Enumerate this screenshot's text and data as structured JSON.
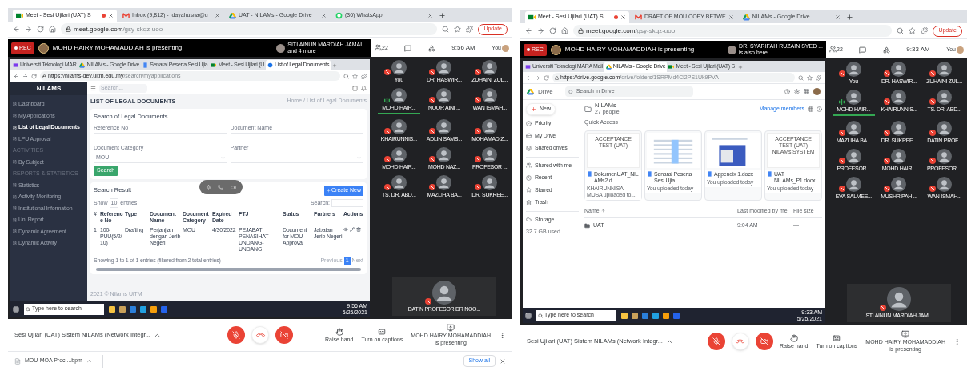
{
  "panels": [
    {
      "browser_tabs": [
        {
          "kind": "meet",
          "label": "Meet - Sesi Ujilari (UAT) S",
          "selected": true
        },
        {
          "kind": "gmail",
          "label": "Inbox (9,812) - Idayahusna@u",
          "selected": false
        },
        {
          "kind": "drive",
          "label": "UAT - NILAMs - Google Drive",
          "selected": false
        },
        {
          "kind": "whatsapp",
          "label": "(36) WhatsApp",
          "selected": false
        }
      ],
      "address": {
        "host": "meet.google.com",
        "path": "/gsy-skqz-uoo"
      },
      "update_button": "Update",
      "meet_header": {
        "rec": "REC",
        "presenter": "MOHD HAIRY MOHAMADDIAH is presenting",
        "also_here": {
          "name": "SITI AINUN MARDIAH JAMAL...",
          "detail": "and 4 more"
        },
        "people_count": "22",
        "time": "9:56 AM",
        "you": "You"
      },
      "shared_screen": {
        "kind": "nilams",
        "tabs": [
          {
            "kind": "mail",
            "label": "Universiti Teknologi MAR",
            "selected": false
          },
          {
            "kind": "drive",
            "label": "NILAMs - Google Drive",
            "selected": false
          },
          {
            "kind": "docs",
            "label": "Senarai Peserta Sesi Ujia",
            "selected": false
          },
          {
            "kind": "meet",
            "label": "Meet - Sesi Ujilari (U",
            "selected": false
          },
          {
            "kind": "page",
            "label": "List of Legal Documents",
            "selected": true
          }
        ],
        "url": {
          "host": "https://nilams-dev.uitm.edu.my",
          "path": "/search/myapplications"
        },
        "app": {
          "logo": "NILAMS",
          "search": "Search...",
          "nav": [
            {
              "kind": "item",
              "label": "Dashboard",
              "selected": false
            },
            {
              "kind": "item",
              "label": "My Applications",
              "selected": false
            },
            {
              "kind": "item",
              "label": "List of Legal Documents",
              "selected": true
            },
            {
              "kind": "item",
              "label": "LPU Approval",
              "selected": false
            },
            {
              "kind": "section",
              "label": "ACTIVITIES",
              "selected": false
            },
            {
              "kind": "item",
              "label": "By Subject",
              "selected": false
            },
            {
              "kind": "section",
              "label": "REPORTS & STATISTICS",
              "selected": false
            },
            {
              "kind": "item",
              "label": "Statistics",
              "selected": false
            },
            {
              "kind": "item",
              "label": "Activity Monitoring",
              "selected": false
            },
            {
              "kind": "item",
              "label": "Institutional Information",
              "selected": false
            },
            {
              "kind": "item",
              "label": "Uni Report",
              "selected": false
            },
            {
              "kind": "item",
              "label": "Dynamic Agreement",
              "selected": false
            },
            {
              "kind": "item",
              "label": "Dynamic Activity",
              "selected": false
            }
          ],
          "heading": "LIST OF LEGAL DOCUMENTS",
          "breadcrumb": "Home / List of Legal Documents",
          "search_card": {
            "title": "Search of Legal Documents",
            "fields": [
              {
                "kind": "text",
                "label": "Reference No"
              },
              {
                "kind": "text",
                "label": "Document Name"
              },
              {
                "kind": "select",
                "label": "Document Category",
                "value": "MOU"
              },
              {
                "kind": "select",
                "label": "Partner"
              }
            ],
            "button": "Search"
          },
          "results": {
            "title": "Search Result",
            "create": "Create New",
            "show": "Show",
            "page_size": "10",
            "entries": "entries",
            "search_label": "Search:",
            "columns": [
              "#",
              "Reference No",
              "Type",
              "Document Name",
              "Document Category",
              "Expired Date",
              "PTJ",
              "Status",
              "Partners",
              "Actions"
            ],
            "rows": [
              [
                "1",
                "100-PUU(5/2/10)",
                "Drafting",
                "Perjanjian dengan Jerib Negeri",
                "MOU",
                "4/30/2022",
                "PEJABAT PENASIHAT UNDANG-UNDANG",
                "Document for MOU Approval",
                "Jabatan Jerib Negeri"
              ]
            ],
            "info": "Showing 1 to 1 of 1 entries (filtered from 2 total entries)",
            "prev": "Previous",
            "page": "1",
            "next": "Next"
          },
          "footer": "2021 © Nilams UiTM"
        },
        "taskbar": {
          "search": "Type here to search",
          "time": "9:56 AM",
          "date": "5/25/2021"
        }
      },
      "participants": [
        {
          "name": "You",
          "speaking": false
        },
        {
          "name": "DR. HASWIR...",
          "speaking": false
        },
        {
          "name": "ZUHAINI ZUL...",
          "speaking": false
        },
        {
          "name": "MOHD HAIR...",
          "speaking": true
        },
        {
          "name": "NOOR AINI ...",
          "speaking": false
        },
        {
          "name": "WAN ISMAH...",
          "speaking": false
        },
        {
          "name": "KHAIRUNNIS...",
          "speaking": false
        },
        {
          "name": "ADLIN SAMS...",
          "speaking": false
        },
        {
          "name": "MOHAMAD Z...",
          "speaking": false
        },
        {
          "name": "MOHD HAIR...",
          "speaking": false
        },
        {
          "name": "MOHD NAZ...",
          "speaking": false
        },
        {
          "name": "PROFESOR ...",
          "speaking": false
        },
        {
          "name": "TS. DR. ABD...",
          "speaking": false
        },
        {
          "name": "MAZLIHA BA...",
          "speaking": false
        },
        {
          "name": "DR. SUKREE...",
          "speaking": false
        }
      ],
      "featured": {
        "name": "DATIN PROFESOR DR NOO...",
        "speaking": false
      },
      "meeting_title": "Sesi Ujilari (UAT) Sistem NILAMs (Network Integr...",
      "call_controls": {
        "mic_on": false,
        "camera_on": false
      },
      "actions": [
        {
          "kind": "raise_hand",
          "label": "Raise hand"
        },
        {
          "kind": "captions",
          "label": "Turn on captions"
        },
        {
          "kind": "presenting",
          "label": "MOHD HAIRY MOHAMADDIAH",
          "detail": "is presenting"
        }
      ],
      "downloads": {
        "file": "MOU-MOA Proc....bpm",
        "show_all": "Show all"
      }
    },
    {
      "browser_tabs": [
        {
          "kind": "meet",
          "label": "Meet - Sesi Ujilari (UAT) S",
          "selected": true
        },
        {
          "kind": "gmail",
          "label": "DRAFT OF MOU COPY BETWE",
          "selected": false
        },
        {
          "kind": "drive",
          "label": "NILAMs - Google Drive",
          "selected": false
        }
      ],
      "address": {
        "host": "meet.google.com",
        "path": "/gsy-skqz-uoo"
      },
      "update_button": "Update",
      "meet_header": {
        "rec": "REC",
        "presenter": "MOHD HAIRY MOHAMADDIAH is presenting",
        "also_here": {
          "name": "DR. SYARIFAH RUZAIN SYED ...",
          "detail": "is also here"
        },
        "people_count": "22",
        "time": "9:33 AM",
        "you": "You"
      },
      "shared_screen": {
        "kind": "drive",
        "tabs": [
          {
            "kind": "mail",
            "label": "Universiti Teknologi MARA Mail",
            "selected": false
          },
          {
            "kind": "drive",
            "label": "NILAMs - Google Drive",
            "selected": true
          },
          {
            "kind": "meet",
            "label": "Meet - Sesi Ujilari (UAT) S",
            "selected": false
          }
        ],
        "url": {
          "host": "https://drive.google.com",
          "path": "/drive/folders/1SRPMd4Cl2PS1Uk9PVA"
        },
        "app": {
          "logo": "Drive",
          "search": "Search in Drive",
          "new": "New",
          "nav": [
            {
              "kind": "priority",
              "label": "Priority"
            },
            {
              "kind": "my_drive",
              "label": "My Drive"
            },
            {
              "kind": "shared_drives",
              "label": "Shared drives"
            },
            {
              "kind": "shared",
              "label": "Shared with me"
            },
            {
              "kind": "recent",
              "label": "Recent"
            },
            {
              "kind": "starred",
              "label": "Starred"
            },
            {
              "kind": "trash",
              "label": "Trash"
            }
          ],
          "storage": {
            "label": "Storage",
            "used": "32.7 GB used"
          },
          "folder": {
            "name": "NILAMs",
            "people": "27 people",
            "manage": "Manage members"
          },
          "quick_access": {
            "title": "Quick Access",
            "files": [
              {
                "kind": "text",
                "name": "DokumenUAT_NILAMs2.d...",
                "detail": "KHAIRUNNISA MUSA uploaded to...",
                "thumbnail_text": "ACCEPTANCE TEST (UAT)"
              },
              {
                "kind": "table",
                "name": "Senarai Peserta Sesi Ujia...",
                "detail": "You uploaded today"
              },
              {
                "kind": "screenshot",
                "name": "Appendix 1.docx",
                "detail": "You uploaded today"
              },
              {
                "kind": "text",
                "name": "UAT NILAMs_P1.docx",
                "detail": "You uploaded today",
                "thumbnail_text": "ACCEPTANCE TEST (UAT) NILAMs SYSTEM"
              }
            ]
          },
          "list": {
            "columns": [
              "Name",
              "Last modified by me",
              "File size"
            ],
            "rows": [
              {
                "name": "UAT",
                "modified": "9:04 AM",
                "size": "—"
              }
            ]
          }
        },
        "taskbar": {
          "search": "Type here to search",
          "time": "9:33 AM",
          "date": "5/25/2021"
        }
      },
      "participants": [
        {
          "name": "You",
          "speaking": false
        },
        {
          "name": "DR. HASWIR...",
          "speaking": false
        },
        {
          "name": "ZUHAINI ZUL...",
          "speaking": false
        },
        {
          "name": "MOHD HAIR...",
          "speaking": true
        },
        {
          "name": "KHAIRUNNIS...",
          "speaking": false
        },
        {
          "name": "TS. DR. ABD...",
          "speaking": false
        },
        {
          "name": "MAZLIHA BA...",
          "speaking": false
        },
        {
          "name": "DR. SUKREE...",
          "speaking": false
        },
        {
          "name": "DATIN PROF...",
          "speaking": false
        },
        {
          "name": "PROFESOR...",
          "speaking": false
        },
        {
          "name": "MOHD HAIR...",
          "speaking": false
        },
        {
          "name": "PROFESOR ...",
          "speaking": false
        },
        {
          "name": "EVA SALMEE...",
          "speaking": false
        },
        {
          "name": "MUSHRIPAH ...",
          "speaking": false
        },
        {
          "name": "WAN ISMAH...",
          "speaking": false
        }
      ],
      "featured": {
        "name": "STI AINUN MARDIAH JAM...",
        "speaking": false
      },
      "meeting_title": "Sesi Ujilari (UAT) Sistem NILAMs (Network Integr...",
      "call_controls": {
        "mic_on": false,
        "camera_on": false
      },
      "actions": [
        {
          "kind": "raise_hand",
          "label": "Raise hand"
        },
        {
          "kind": "captions",
          "label": "Turn on captions"
        },
        {
          "kind": "presenting",
          "label": "MOHD HAIRY MOHAMADDIAH",
          "detail": "is presenting"
        }
      ]
    }
  ]
}
